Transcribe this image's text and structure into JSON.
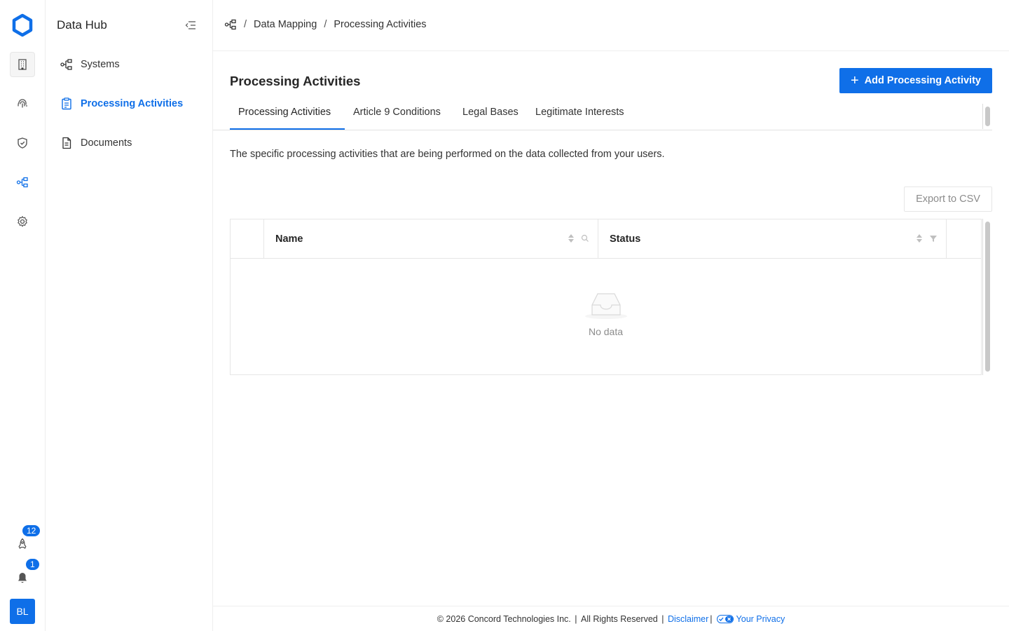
{
  "colors": {
    "accent": "#0f6fe8",
    "border": "#eeeeee",
    "muted": "#8c8c8c"
  },
  "rail": {
    "icons": [
      "building-icon",
      "fingerprint-icon",
      "shield-check-icon",
      "data-map-icon",
      "gear-icon",
      "rocket-icon",
      "bell-icon"
    ],
    "rocket_badge": "12",
    "bell_badge": "1",
    "avatar_initials": "BL"
  },
  "subnav": {
    "title": "Data Hub",
    "items": [
      {
        "label": "Systems",
        "icon": "systems-icon"
      },
      {
        "label": "Processing Activities",
        "icon": "clipboard-icon",
        "active": true
      },
      {
        "label": "Documents",
        "icon": "document-icon"
      }
    ]
  },
  "breadcrumb": {
    "items": [
      "Data Mapping",
      "Processing Activities"
    ]
  },
  "page": {
    "title": "Processing Activities",
    "add_button": "Add Processing Activity",
    "tabs": [
      "Processing Activities",
      "Article 9 Conditions",
      "Legal Bases",
      "Legitimate Interests"
    ],
    "description": "The specific processing activities that are being performed on the data collected from your users.",
    "export_button": "Export to CSV"
  },
  "table": {
    "columns": [
      "Name",
      "Status"
    ],
    "empty_text": "No data"
  },
  "footer": {
    "copyright": "© 2026 Concord Technologies Inc.",
    "rights": "All Rights Reserved",
    "disclaimer": "Disclaimer",
    "privacy": "Your Privacy"
  }
}
